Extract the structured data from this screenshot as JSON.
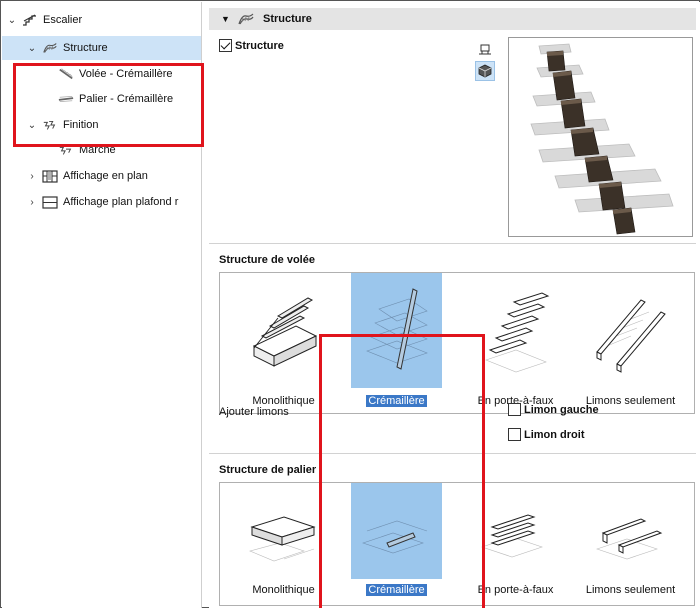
{
  "tree": {
    "items": [
      {
        "label": "Escalier",
        "twisty": "down",
        "icon": "stair-icon"
      },
      {
        "label": "Structure",
        "twisty": "down",
        "icon": "structure-icon",
        "selected": true
      },
      {
        "label": "Volée - Crémaillère",
        "icon": "stringer-flight-icon"
      },
      {
        "label": "Palier - Crémaillère",
        "icon": "stringer-landing-icon"
      },
      {
        "label": "Finition",
        "twisty": "down",
        "icon": "finish-icon"
      },
      {
        "label": "Marche",
        "icon": "tread-icon"
      },
      {
        "label": "Affichage en plan",
        "twisty": "right",
        "icon": "floor-plan-icon"
      },
      {
        "label": "Affichage plan plafond r",
        "twisty": "right",
        "icon": "ceiling-plan-icon"
      }
    ]
  },
  "header": {
    "title": "Structure"
  },
  "structure_checkbox": {
    "label": "Structure",
    "checked": true
  },
  "view_buttons": [
    {
      "icon": "2d-view-icon",
      "active": false
    },
    {
      "icon": "3d-view-icon",
      "active": true
    }
  ],
  "flight_structure": {
    "title": "Structure de volée",
    "options": [
      {
        "label": "Monolithique",
        "selected": false
      },
      {
        "label": "Crémaillère",
        "selected": true
      },
      {
        "label": "En porte-à-faux",
        "selected": false
      },
      {
        "label": "Limons seulement",
        "selected": false
      }
    ]
  },
  "stringers": {
    "label": "Ajouter limons",
    "left": {
      "label": "Limon gauche",
      "checked": false
    },
    "right": {
      "label": "Limon droit",
      "checked": false
    }
  },
  "landing_structure": {
    "title": "Structure de palier",
    "options": [
      {
        "label": "Monolithique",
        "selected": false
      },
      {
        "label": "Crémaillère",
        "selected": true
      },
      {
        "label": "En porte-à-faux",
        "selected": false
      },
      {
        "label": "Limons seulement",
        "selected": false
      }
    ]
  },
  "colors": {
    "selection": "#cde3f7",
    "tile_selected": "#9bc6ec",
    "caption_selected": "#3b78c7",
    "annotation": "#e0141c"
  }
}
